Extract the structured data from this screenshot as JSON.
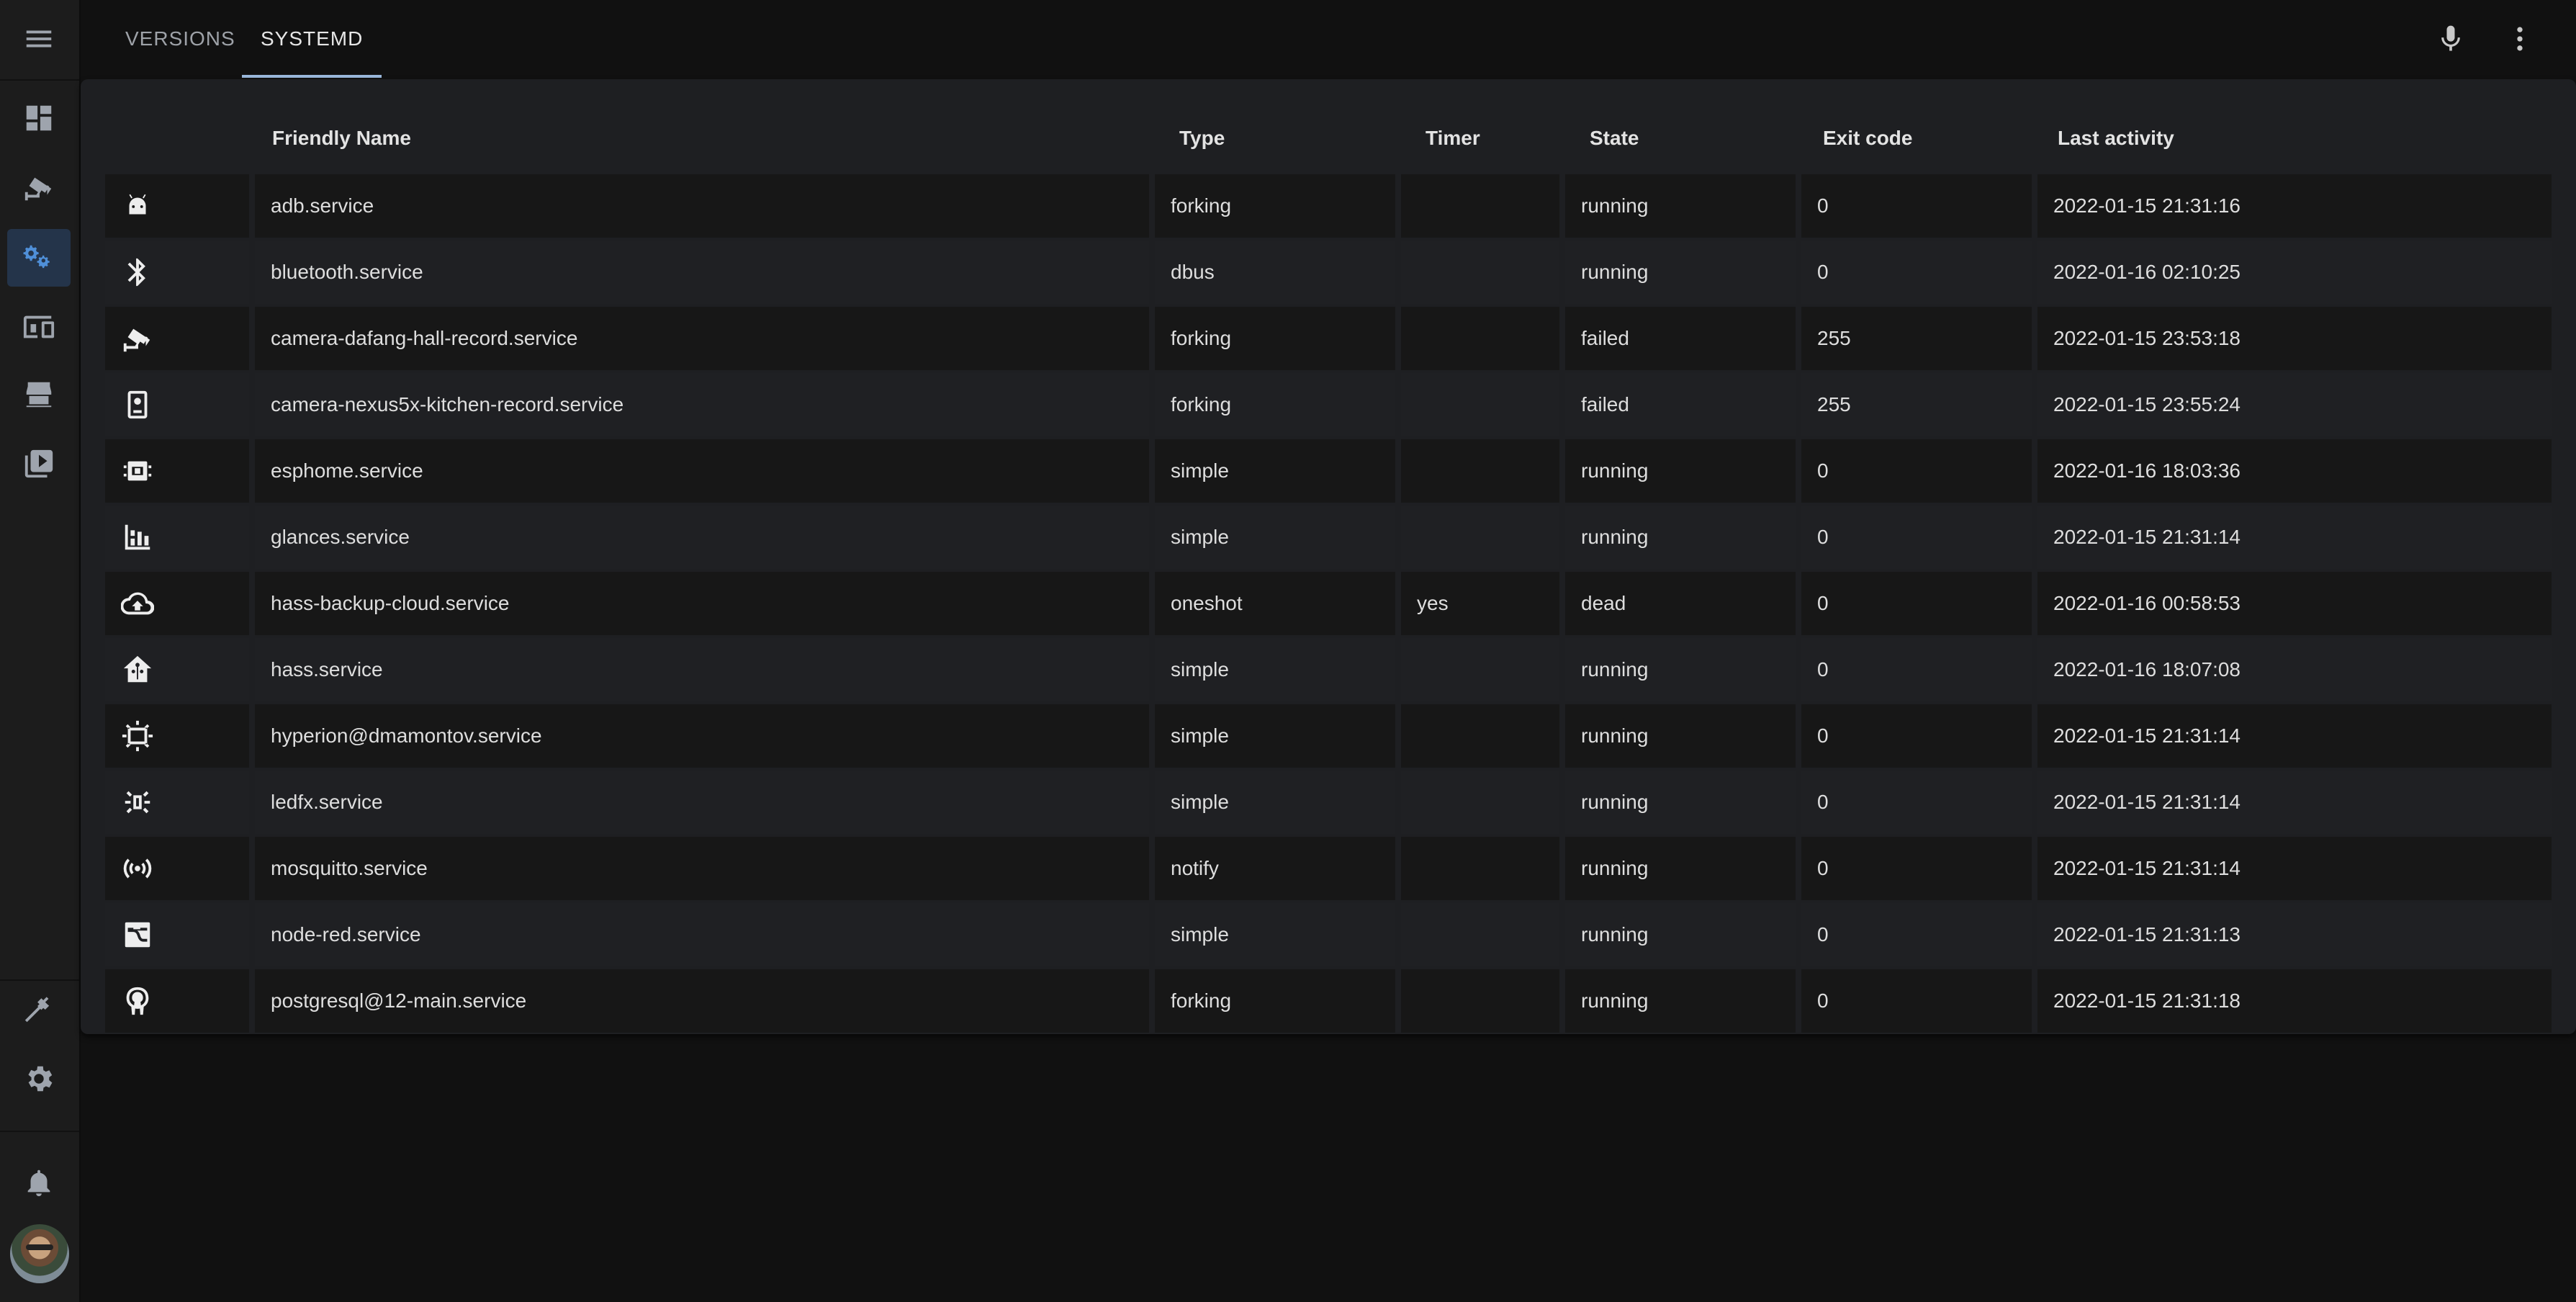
{
  "tabs": [
    {
      "label": "VERSIONS",
      "active": false
    },
    {
      "label": "SYSTEMD",
      "active": true
    }
  ],
  "sidebar": {
    "items": [
      {
        "icon": "menu-icon"
      },
      {
        "icon": "dashboard-icon"
      },
      {
        "icon": "cctv-icon"
      },
      {
        "icon": "cogs-icon",
        "active": true
      },
      {
        "icon": "devices-icon"
      },
      {
        "icon": "hacs-icon"
      },
      {
        "icon": "media-icon"
      },
      {
        "icon": "hammer-icon"
      },
      {
        "icon": "settings-icon"
      },
      {
        "icon": "bell-icon"
      }
    ]
  },
  "table": {
    "headers": [
      "Friendly Name",
      "Type",
      "Timer",
      "State",
      "Exit code",
      "Last activity"
    ],
    "rows": [
      {
        "icon": "android-icon",
        "name": "adb.service",
        "type": "forking",
        "timer": "",
        "state": "running",
        "exit": "0",
        "activity": "2022-01-15 21:31:16"
      },
      {
        "icon": "bluetooth-icon",
        "name": "bluetooth.service",
        "type": "dbus",
        "timer": "",
        "state": "running",
        "exit": "0",
        "activity": "2022-01-16 02:10:25"
      },
      {
        "icon": "cctv-icon",
        "name": "camera-dafang-hall-record.service",
        "type": "forking",
        "timer": "",
        "state": "failed",
        "exit": "255",
        "activity": "2022-01-15 23:53:18"
      },
      {
        "icon": "phone-camera-icon",
        "name": "camera-nexus5x-kitchen-record.service",
        "type": "forking",
        "timer": "",
        "state": "failed",
        "exit": "255",
        "activity": "2022-01-15 23:55:24"
      },
      {
        "icon": "chip-icon",
        "name": "esphome.service",
        "type": "simple",
        "timer": "",
        "state": "running",
        "exit": "0",
        "activity": "2022-01-16 18:03:36"
      },
      {
        "icon": "chart-icon",
        "name": "glances.service",
        "type": "simple",
        "timer": "",
        "state": "running",
        "exit": "0",
        "activity": "2022-01-15 21:31:14"
      },
      {
        "icon": "cloud-upload-icon",
        "name": "hass-backup-cloud.service",
        "type": "oneshot",
        "timer": "yes",
        "state": "dead",
        "exit": "0",
        "activity": "2022-01-16 00:58:53"
      },
      {
        "icon": "home-assistant-icon",
        "name": "hass.service",
        "type": "simple",
        "timer": "",
        "state": "running",
        "exit": "0",
        "activity": "2022-01-16 18:07:08"
      },
      {
        "icon": "tv-ambient-icon",
        "name": "hyperion@dmamontov.service",
        "type": "simple",
        "timer": "",
        "state": "running",
        "exit": "0",
        "activity": "2022-01-15 21:31:14"
      },
      {
        "icon": "led-icon",
        "name": "ledfx.service",
        "type": "simple",
        "timer": "",
        "state": "running",
        "exit": "0",
        "activity": "2022-01-15 21:31:14"
      },
      {
        "icon": "broadcast-icon",
        "name": "mosquitto.service",
        "type": "notify",
        "timer": "",
        "state": "running",
        "exit": "0",
        "activity": "2022-01-15 21:31:14"
      },
      {
        "icon": "node-red-icon",
        "name": "node-red.service",
        "type": "simple",
        "timer": "",
        "state": "running",
        "exit": "0",
        "activity": "2022-01-15 21:31:13"
      },
      {
        "icon": "elephant-icon",
        "name": "postgresql@12-main.service",
        "type": "forking",
        "timer": "",
        "state": "running",
        "exit": "0",
        "activity": "2022-01-15 21:31:18"
      }
    ]
  }
}
